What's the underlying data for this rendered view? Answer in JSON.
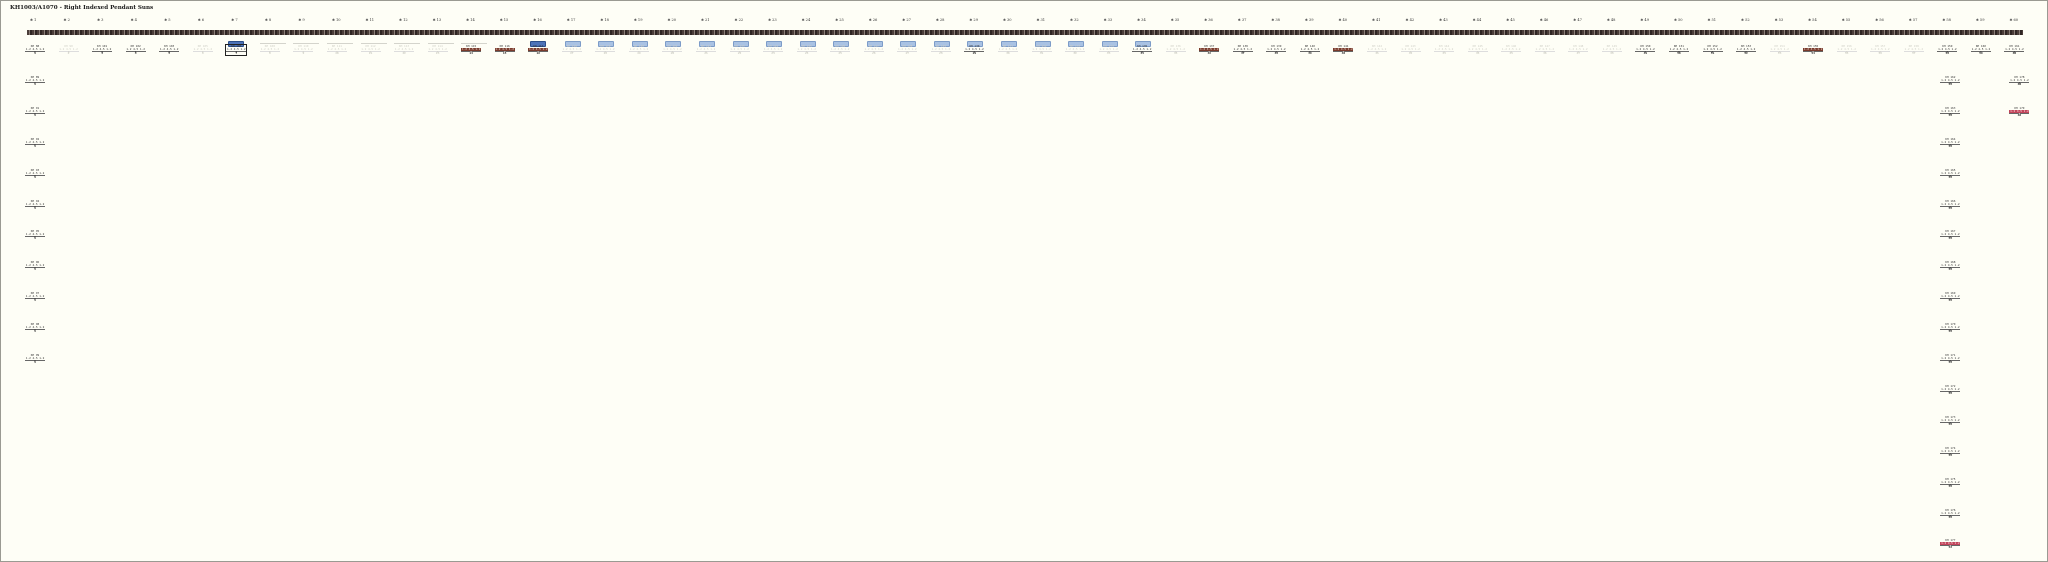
{
  "page": {
    "title": "KH1003/A1070 - Right Indexed Pendant Suns"
  },
  "columns": [
    "1",
    "2",
    "3",
    "4",
    "5",
    "6",
    "7",
    "8",
    "9",
    "10",
    "11",
    "12",
    "13",
    "14",
    "15",
    "16",
    "17",
    "18",
    "19",
    "20",
    "21",
    "22",
    "23",
    "24",
    "25",
    "26",
    "27",
    "28",
    "29",
    "30",
    "31",
    "32",
    "33",
    "34",
    "35",
    "36",
    "37",
    "38",
    "39",
    "40",
    "41",
    "42",
    "43",
    "44",
    "45",
    "46",
    "47",
    "48",
    "49",
    "50",
    "51",
    "52",
    "53",
    "54",
    "55",
    "56",
    "57",
    "58",
    "59",
    "60"
  ],
  "row0_cards": [
    {
      "col": 0,
      "l1": "KH 88",
      "l2": "1.2 4.5 1.2 8",
      "l3": "1",
      "style": "normal"
    },
    {
      "col": 1,
      "l1": "KH 90",
      "l2": "1.2 4.5 1.2 8",
      "l3": "2",
      "style": "faint"
    },
    {
      "col": 2,
      "l1": "KH 101",
      "l2": "1.2 4.5 1.2 8",
      "l3": "3",
      "style": "normal"
    },
    {
      "col": 3,
      "l1": "KH 102",
      "l2": "1.2 4.5 1.2 8",
      "l3": "4",
      "style": "normal"
    },
    {
      "col": 4,
      "l1": "KH 103",
      "l2": "1.2 4.5 1.2 8",
      "l3": "5",
      "style": "normal"
    },
    {
      "col": 5,
      "l1": "KH 105",
      "l2": "1.2 4.5 1.2 8",
      "l3": "6",
      "style": "faint"
    },
    {
      "col": 6,
      "l1": "KH 106",
      "l2": "1.2 4.5 1.2 8",
      "l3": "7",
      "style": "selected"
    },
    {
      "col": 7,
      "l1": "KH 108",
      "l2": "1.2 4.5 1.2 8",
      "l3": "8",
      "style": "faint"
    },
    {
      "col": 8,
      "l1": "KH 110",
      "l2": "1.2 4.5 1.2 8",
      "l3": "9",
      "style": "faint"
    },
    {
      "col": 9,
      "l1": "KH 111",
      "l2": "1.2 4.5 1.2 8",
      "l3": "10",
      "style": "faint"
    },
    {
      "col": 10,
      "l1": "KH 112",
      "l2": "1.2 4.5 1.2 8",
      "l3": "11",
      "style": "faint"
    },
    {
      "col": 11,
      "l1": "KH 113",
      "l2": "1.2 4.5 1.2 8",
      "l3": "12",
      "style": "faint"
    },
    {
      "col": 12,
      "l1": "KH 114",
      "l2": "1.2 4.5 1.2 8",
      "l3": "13",
      "style": "faint"
    },
    {
      "col": 13,
      "l1": "KH 115",
      "l2": "1.2 4.5 1.2 8",
      "l3": "14",
      "style": "hl"
    },
    {
      "col": 14,
      "l1": "KH 116",
      "l2": "1.2 4.5 1.2 8",
      "l3": "15",
      "style": "hl"
    },
    {
      "col": 15,
      "l1": "KH 117",
      "l2": "1.2 4.5 1.2 8",
      "l3": "16",
      "style": "hl"
    },
    {
      "col": 16,
      "l1": "KH 118",
      "l2": "1.2 4.5 1.2 8",
      "l3": "17",
      "style": "faint"
    },
    {
      "col": 17,
      "l1": "KH 119",
      "l2": "1.2 4.5 1.2 8",
      "l3": "18",
      "style": "faint"
    },
    {
      "col": 18,
      "l1": "KH 120",
      "l2": "1.2 4.5 1.2 8",
      "l3": "19",
      "style": "faint"
    },
    {
      "col": 19,
      "l1": "KH 121",
      "l2": "1.2 4.5 1.2 8",
      "l3": "20",
      "style": "faint"
    },
    {
      "col": 20,
      "l1": "KH 122",
      "l2": "1.2 4.5 1.2 8",
      "l3": "21",
      "style": "faint"
    },
    {
      "col": 21,
      "l1": "KH 123",
      "l2": "1.2 4.5 1.2 8",
      "l3": "22",
      "style": "faint"
    },
    {
      "col": 22,
      "l1": "KH 124",
      "l2": "1.2 4.5 1.2 8",
      "l3": "23",
      "style": "faint"
    },
    {
      "col": 23,
      "l1": "KH 125",
      "l2": "1.2 4.5 1.2 8",
      "l3": "24",
      "style": "faint"
    },
    {
      "col": 24,
      "l1": "KH 126",
      "l2": "1.2 4.5 1.2 8",
      "l3": "25",
      "style": "faint"
    },
    {
      "col": 25,
      "l1": "KH 127",
      "l2": "1.2 4.5 1.2 8",
      "l3": "26",
      "style": "faint"
    },
    {
      "col": 26,
      "l1": "KH 128",
      "l2": "1.2 4.5 1.2 8",
      "l3": "27",
      "style": "faint"
    },
    {
      "col": 27,
      "l1": "KH 129",
      "l2": "1.2 4.5 1.2 8",
      "l3": "28",
      "style": "faint"
    },
    {
      "col": 28,
      "l1": "KH 130",
      "l2": "1.2 4.5 1.2 8",
      "l3": "29",
      "style": "normal"
    },
    {
      "col": 29,
      "l1": "KH 131",
      "l2": "1.2 4.5 1.2 8",
      "l3": "30",
      "style": "faint"
    },
    {
      "col": 30,
      "l1": "KH 132",
      "l2": "1.2 4.5 1.2 8",
      "l3": "31",
      "style": "faint"
    },
    {
      "col": 31,
      "l1": "KH 133",
      "l2": "1.2 4.5 1.2 8",
      "l3": "32",
      "style": "faint"
    },
    {
      "col": 32,
      "l1": "KH 134",
      "l2": "1.2 4.5 1.2 8",
      "l3": "33",
      "style": "faint"
    },
    {
      "col": 33,
      "l1": "KH 135",
      "l2": "1.2 4.5 1.2 8",
      "l3": "34",
      "style": "normal"
    },
    {
      "col": 34,
      "l1": "KH 136",
      "l2": "1.2 4.5 1.2 8",
      "l3": "35",
      "style": "faint"
    },
    {
      "col": 35,
      "l1": "KH 137",
      "l2": "1.2 4.5 1.2 8",
      "l3": "36",
      "style": "hl"
    },
    {
      "col": 36,
      "l1": "KH 138",
      "l2": "1.2 4.5 1.2 8",
      "l3": "37",
      "style": "normal"
    },
    {
      "col": 37,
      "l1": "KH 139",
      "l2": "1.2 4.5 1.2 8",
      "l3": "38",
      "style": "normal"
    },
    {
      "col": 38,
      "l1": "KH 140",
      "l2": "1.2 4.5 1.2 8",
      "l3": "39",
      "style": "normal"
    },
    {
      "col": 39,
      "l1": "KH 141",
      "l2": "1.2 4.5 1.2 8",
      "l3": "40",
      "style": "hl"
    },
    {
      "col": 40,
      "l1": "KH 142",
      "l2": "1.2 4.5 1.2 8",
      "l3": "41",
      "style": "faint"
    },
    {
      "col": 41,
      "l1": "KH 143",
      "l2": "1.2 4.5 1.2 8",
      "l3": "42",
      "style": "faint"
    },
    {
      "col": 42,
      "l1": "KH 144",
      "l2": "1.2 4.5 1.2 8",
      "l3": "43",
      "style": "faint"
    },
    {
      "col": 43,
      "l1": "KH 145",
      "l2": "1.2 4.5 1.2 8",
      "l3": "44",
      "style": "faint"
    },
    {
      "col": 44,
      "l1": "KH 146",
      "l2": "1.2 4.5 1.2 8",
      "l3": "45",
      "style": "faint"
    },
    {
      "col": 45,
      "l1": "KH 147",
      "l2": "1.2 4.5 1.2 8",
      "l3": "46",
      "style": "faint"
    },
    {
      "col": 46,
      "l1": "KH 148",
      "l2": "1.2 4.5 1.2 8",
      "l3": "47",
      "style": "faint"
    },
    {
      "col": 47,
      "l1": "KH 149",
      "l2": "1.2 4.5 1.2 8",
      "l3": "48",
      "style": "faint"
    },
    {
      "col": 48,
      "l1": "KH 150",
      "l2": "1.2 4.5 1.2 8",
      "l3": "49",
      "style": "normal"
    },
    {
      "col": 49,
      "l1": "KH 151",
      "l2": "1.2 4.5 1.2 8",
      "l3": "50",
      "style": "normal"
    },
    {
      "col": 50,
      "l1": "KH 152",
      "l2": "1.2 4.5 1.2 8",
      "l3": "51",
      "style": "normal"
    },
    {
      "col": 51,
      "l1": "KH 153",
      "l2": "1.2 4.5 1.2 8",
      "l3": "52",
      "style": "normal"
    },
    {
      "col": 52,
      "l1": "KH 154",
      "l2": "1.2 4.5 1.2 8",
      "l3": "53",
      "style": "faint"
    },
    {
      "col": 53,
      "l1": "KH 155",
      "l2": "1.2 4.5 1.2 8",
      "l3": "54",
      "style": "hl"
    },
    {
      "col": 54,
      "l1": "KH 156",
      "l2": "1.2 4.5 1.2 8",
      "l3": "55",
      "style": "faint"
    },
    {
      "col": 55,
      "l1": "KH 157",
      "l2": "1.2 4.5 1.2 8",
      "l3": "56",
      "style": "faint"
    },
    {
      "col": 56,
      "l1": "KH 158",
      "l2": "1.2 4.5 1.2 8",
      "l3": "57",
      "style": "faint"
    },
    {
      "col": 57,
      "l1": "KH 159",
      "l2": "1.2 4.5 1.2 8",
      "l3": "58",
      "style": "normal"
    },
    {
      "col": 58,
      "l1": "KH 160",
      "l2": "1.2 4.5 1.2 8",
      "l3": "59",
      "style": "normal"
    },
    {
      "col": 59,
      "l1": "KH 161",
      "l2": "1.2 4.5 1.2 8",
      "l3": "60",
      "style": "normal"
    }
  ],
  "col1_stack": [
    {
      "l1": "KH 89",
      "l2": "1.2 4.5 1.2 8",
      "l3": "1"
    },
    {
      "l1": "KH 91",
      "l2": "1.2 4.5 1.2 8",
      "l3": "1"
    },
    {
      "l1": "KH 92",
      "l2": "1.2 4.5 1.2 8",
      "l3": "1"
    },
    {
      "l1": "KH 93",
      "l2": "1.2 4.5 1.2 8",
      "l3": "1"
    },
    {
      "l1": "KH 94",
      "l2": "1.2 4.5 1.2 8",
      "l3": "1"
    },
    {
      "l1": "KH 95",
      "l2": "1.2 4.5 1.2 8",
      "l3": "1"
    },
    {
      "l1": "KH 96",
      "l2": "1.2 4.5 1.2 8",
      "l3": "1"
    },
    {
      "l1": "KH 97",
      "l2": "1.2 4.5 1.2 8",
      "l3": "1"
    },
    {
      "l1": "KH 98",
      "l2": "1.2 4.5 1.2 8",
      "l3": "1"
    },
    {
      "l1": "KH 99",
      "l2": "1.2 4.5 1.2 8",
      "l3": "1"
    }
  ],
  "col58_stack": [
    {
      "l1": "KH 162",
      "l2": "1.2 4.5 1.2 8",
      "l3": "58",
      "style": "normal"
    },
    {
      "l1": "KH 163",
      "l2": "1.2 4.5 1.2 8",
      "l3": "58",
      "style": "normal"
    },
    {
      "l1": "KH 164",
      "l2": "1.2 4.5 1.2 8",
      "l3": "58",
      "style": "normal"
    },
    {
      "l1": "KH 165",
      "l2": "1.2 4.5 1.2 8",
      "l3": "58",
      "style": "normal"
    },
    {
      "l1": "KH 166",
      "l2": "1.2 4.5 1.2 8",
      "l3": "58",
      "style": "normal"
    },
    {
      "l1": "KH 167",
      "l2": "1.2 4.5 1.2 8",
      "l3": "58",
      "style": "normal"
    },
    {
      "l1": "KH 168",
      "l2": "1.2 4.5 1.2 8",
      "l3": "58",
      "style": "normal"
    },
    {
      "l1": "KH 169",
      "l2": "1.2 4.5 1.2 8",
      "l3": "58",
      "style": "normal"
    },
    {
      "l1": "KH 170",
      "l2": "1.2 4.5 1.2 8",
      "l3": "58",
      "style": "normal"
    },
    {
      "l1": "KH 171",
      "l2": "1.2 4.5 1.2 8",
      "l3": "58",
      "style": "normal"
    },
    {
      "l1": "KH 172",
      "l2": "1.2 4.5 1.2 8",
      "l3": "58",
      "style": "normal"
    },
    {
      "l1": "KH 173",
      "l2": "1.2 4.5 1.2 8",
      "l3": "58",
      "style": "normal"
    },
    {
      "l1": "KH 174",
      "l2": "1.2 4.5 1.2 8",
      "l3": "58",
      "style": "normal"
    },
    {
      "l1": "KH 175",
      "l2": "1.2 4.5 1.2 8",
      "l3": "58",
      "style": "normal"
    },
    {
      "l1": "KH 176",
      "l2": "1.2 4.5 1.2 8",
      "l3": "58",
      "style": "normal"
    },
    {
      "l1": "KH 177",
      "l2": "1.2 4.5 1.2 8",
      "l3": "58",
      "style": "hl-red"
    }
  ],
  "col60_stack": [
    {
      "l1": "KH 178",
      "l2": "1.2 4.5 1.2 8",
      "l3": "60",
      "style": "normal"
    },
    {
      "l1": "KH 179",
      "l2": "1.2 4.5 1.2 8",
      "l3": "60",
      "style": "hl-red"
    }
  ],
  "colors": {
    "background": "#fefef6",
    "banner": "#4a3d39",
    "highlight": "#7a3b2c",
    "highlight_red": "#c2445a",
    "pill": "#a9c2e3",
    "pill_dark": "#4d73b8"
  },
  "icons": {
    "column_pin": "pin-icon"
  }
}
